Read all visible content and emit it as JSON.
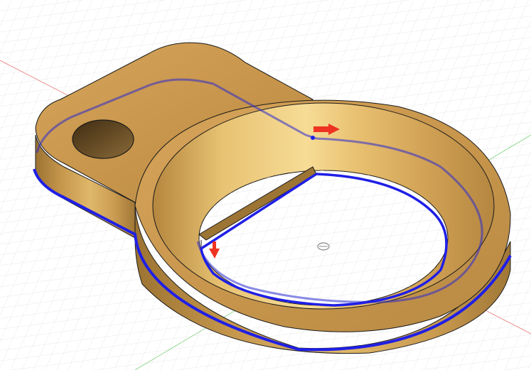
{
  "viewport": {
    "background_color": "#ffffff",
    "grid_color": "#d9d9d9",
    "x_axis_color": "#e87a7a",
    "y_axis_color": "#7fd17f"
  },
  "model": {
    "material_color": "#c79a4a",
    "material_highlight": "#f2cf80",
    "material_shadow": "#8a6428",
    "edge_color": "#1a1a1a",
    "selection_color": "#1f1fe6"
  },
  "direction_arrows": {
    "color": "#ee3322",
    "items": [
      "arrow-right-icon",
      "arrow-down-icon"
    ]
  },
  "origin": {
    "icon": "origin-marker-icon"
  }
}
